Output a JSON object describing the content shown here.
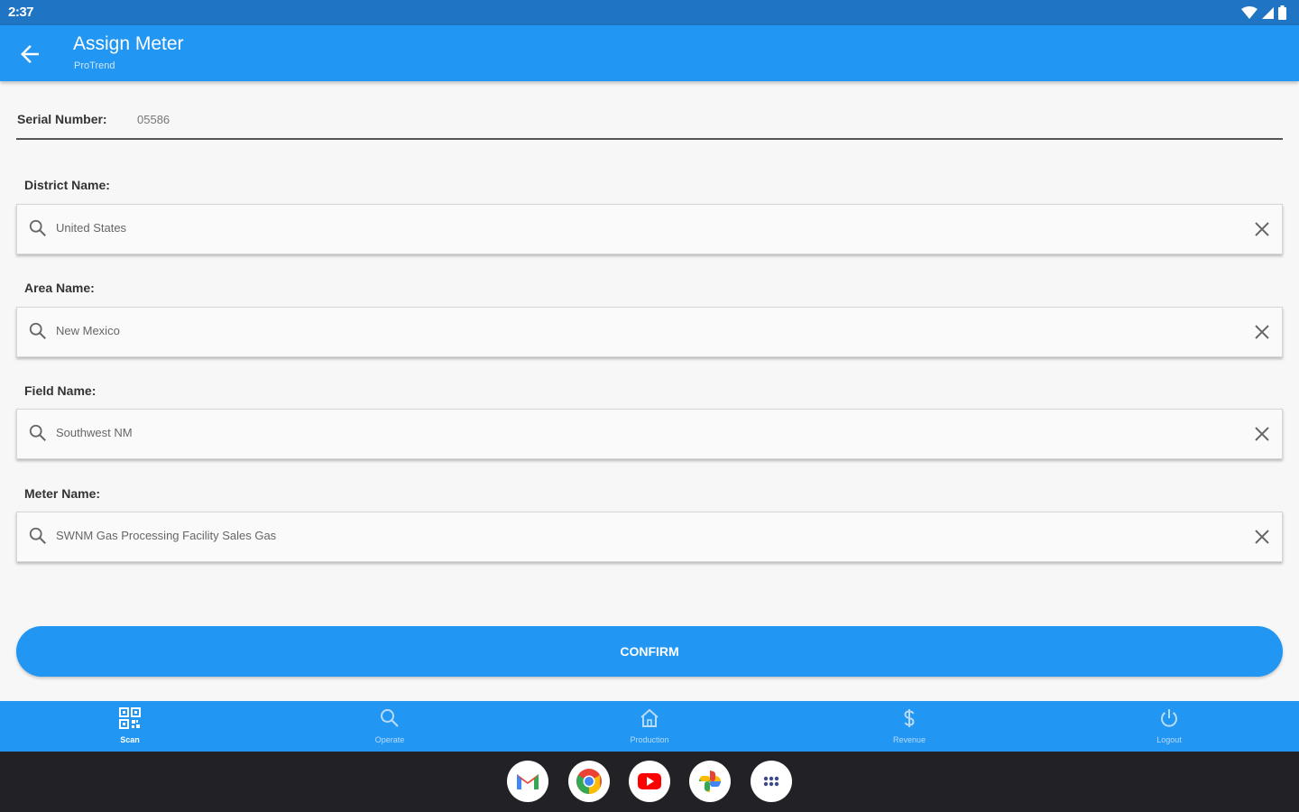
{
  "status_bar": {
    "time": "2:37"
  },
  "app_bar": {
    "title": "Assign Meter",
    "subtitle": "ProTrend"
  },
  "serial": {
    "label": "Serial Number:",
    "value": "05586"
  },
  "fields": [
    {
      "label": "District Name:",
      "value": "United States"
    },
    {
      "label": "Area Name:",
      "value": "New Mexico"
    },
    {
      "label": "Field Name:",
      "value": "Southwest NM"
    },
    {
      "label": "Meter Name:",
      "value": "SWNM Gas Processing Facility Sales Gas"
    }
  ],
  "confirm": {
    "label": "CONFIRM"
  },
  "bottom_nav": {
    "items": [
      {
        "label": "Scan",
        "icon": "qr-code-icon",
        "active": true
      },
      {
        "label": "Operate",
        "icon": "search-icon",
        "active": false
      },
      {
        "label": "Production",
        "icon": "home-icon",
        "active": false
      },
      {
        "label": "Revenue",
        "icon": "dollar-icon",
        "active": false
      },
      {
        "label": "Logout",
        "icon": "power-icon",
        "active": false
      }
    ]
  },
  "dock": {
    "apps": [
      {
        "icon": "gmail-icon"
      },
      {
        "icon": "chrome-icon"
      },
      {
        "icon": "youtube-icon"
      },
      {
        "icon": "photos-icon"
      },
      {
        "icon": "app-drawer-icon"
      }
    ]
  },
  "colors": {
    "primary": "#2196f3",
    "status_bar": "#1f74c4",
    "dock": "#222226"
  }
}
